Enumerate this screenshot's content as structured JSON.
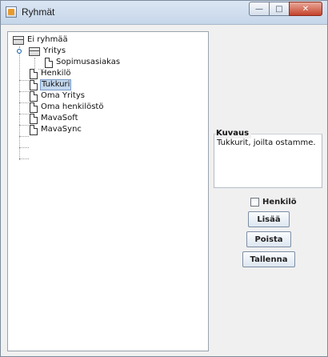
{
  "window": {
    "title": "Ryhmät",
    "icon": "java-cup-icon",
    "controls": {
      "minimize_glyph": "—",
      "maximize_glyph": "□",
      "close_glyph": "✕"
    }
  },
  "tree": {
    "root_label": "Ei ryhmää",
    "group_label": "Yritys",
    "group_child_label": "Sopimusasiakas",
    "items": [
      "Henkilö",
      "Tukkuri",
      "Oma Yritys",
      "Oma henkilöstö",
      "MavaSoft",
      "MavaSync"
    ],
    "selected": "Tukkuri"
  },
  "description": {
    "legend": "Kuvaus",
    "text": "Tukkurit, joilta ostamme."
  },
  "person_checkbox": {
    "label": "Henkilö",
    "checked": false
  },
  "buttons": {
    "add": "Lisää",
    "remove": "Poista",
    "save": "Tallenna"
  }
}
